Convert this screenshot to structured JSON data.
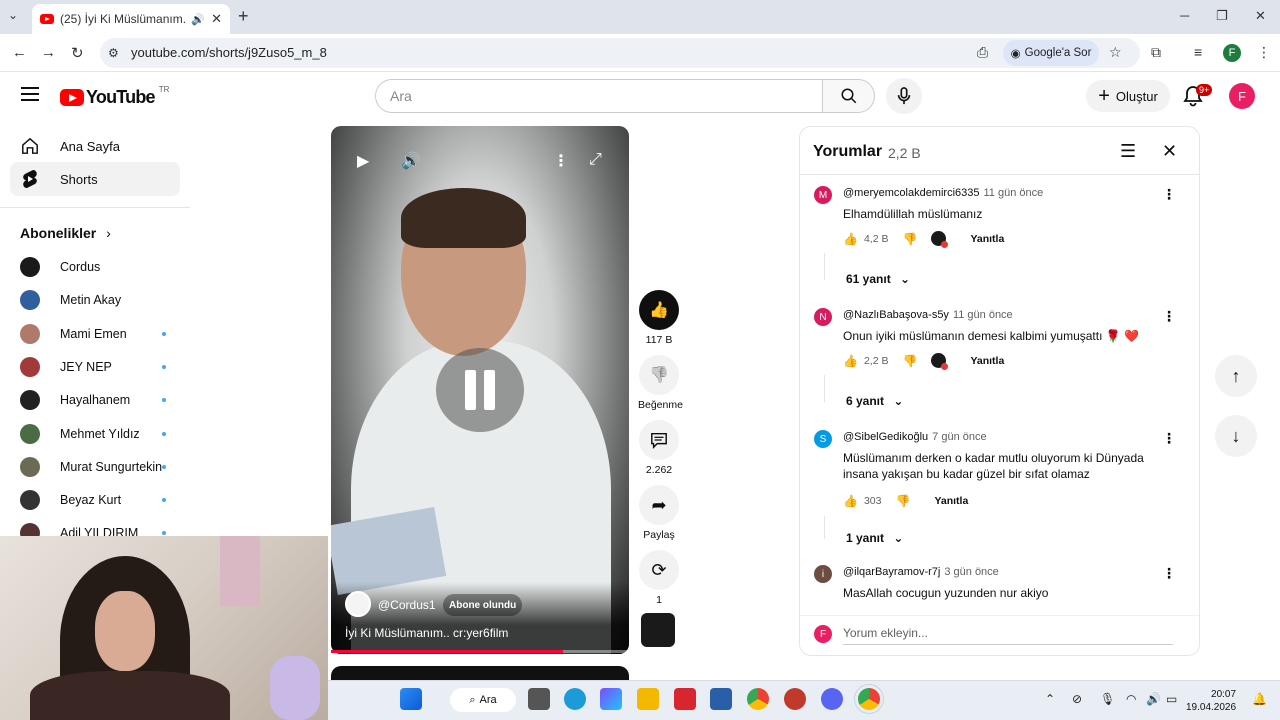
{
  "browser": {
    "tab_title": "(25) İyi Ki Müslümanım.. cr:",
    "url": "youtube.com/shorts/j9Zuso5_m_8",
    "ask_google": "Google'a Sor"
  },
  "header": {
    "logo_text": "YouTube",
    "country": "TR",
    "search_placeholder": "Ara",
    "create_label": "Oluştur",
    "notifications_badge": "9+",
    "avatar_letter": "F"
  },
  "sidebar": {
    "home": "Ana Sayfa",
    "shorts": "Shorts",
    "subs_heading": "Abonelikler",
    "subscriptions": [
      {
        "name": "Cordus",
        "dot": false,
        "color": "#1a1a1a"
      },
      {
        "name": "Metin Akay",
        "dot": false,
        "color": "#2f5f9e"
      },
      {
        "name": "Mami Emen",
        "dot": true,
        "color": "#b07a6a"
      },
      {
        "name": "JEY NEP",
        "dot": true,
        "color": "#a33a3a"
      },
      {
        "name": "Hayalhanem",
        "dot": true,
        "color": "#222222"
      },
      {
        "name": "Mehmet Yıldız",
        "dot": true,
        "color": "#4b6b45"
      },
      {
        "name": "Murat Sungurtekin",
        "dot": true,
        "color": "#6b6b55"
      },
      {
        "name": "Beyaz Kurt",
        "dot": true,
        "color": "#333333"
      },
      {
        "name": "Adil YILDIRIM",
        "dot": true,
        "color": "#553333"
      }
    ]
  },
  "video": {
    "channel": "@Cordus1",
    "subscribed_label": "Abone olundu",
    "title": "İyi Ki Müslümanım.. cr:yer6film",
    "progress": 0.78
  },
  "actions": {
    "likes": "117 B",
    "dislike_label": "Beğenme",
    "comments": "2.262",
    "share_label": "Paylaş",
    "remix_count": "1"
  },
  "comments_panel": {
    "title": "Yorumlar",
    "count": "2,2 B",
    "reply_label": "Yanıtla",
    "input_placeholder": "Yorum ekleyin...",
    "input_avatar": "F",
    "items": [
      {
        "letter": "M",
        "color": "#d81b60",
        "author": "@meryemcolakdemirci6335",
        "time": "11 gün önce",
        "text": "Elhamdülillah müslümanız",
        "likes": "4,2 B",
        "heart": true,
        "replies": "61 yanıt"
      },
      {
        "letter": "N",
        "color": "#d81b60",
        "author": "@NazlıBabaşova-s5y",
        "time": "11 gün önce",
        "text": "Onun iyiki müslümanın demesi kalbimi yumuşattı 🌹 ❤️",
        "likes": "2,2 B",
        "heart": true,
        "replies": "6 yanıt"
      },
      {
        "letter": "S",
        "color": "#039be5",
        "author": "@SibelGedikoğlu",
        "time": "7 gün önce",
        "text": "Müslümanım derken o kadar mutlu oluyorum ki Dünyada insana yakışan bu kadar güzel bir sıfat  olamaz",
        "likes": "303",
        "heart": false,
        "replies": "1 yanıt"
      },
      {
        "letter": "i",
        "color": "#6d4c41",
        "author": "@ilqarBayramov-r7j",
        "time": "3 gün önce",
        "text": "MasAllah cocugun yuzunden nur akiyo",
        "likes": "",
        "heart": false,
        "replies": ""
      }
    ]
  },
  "taskbar": {
    "search_label": "Ara",
    "time": "20:07",
    "date": "19.04.2026"
  }
}
